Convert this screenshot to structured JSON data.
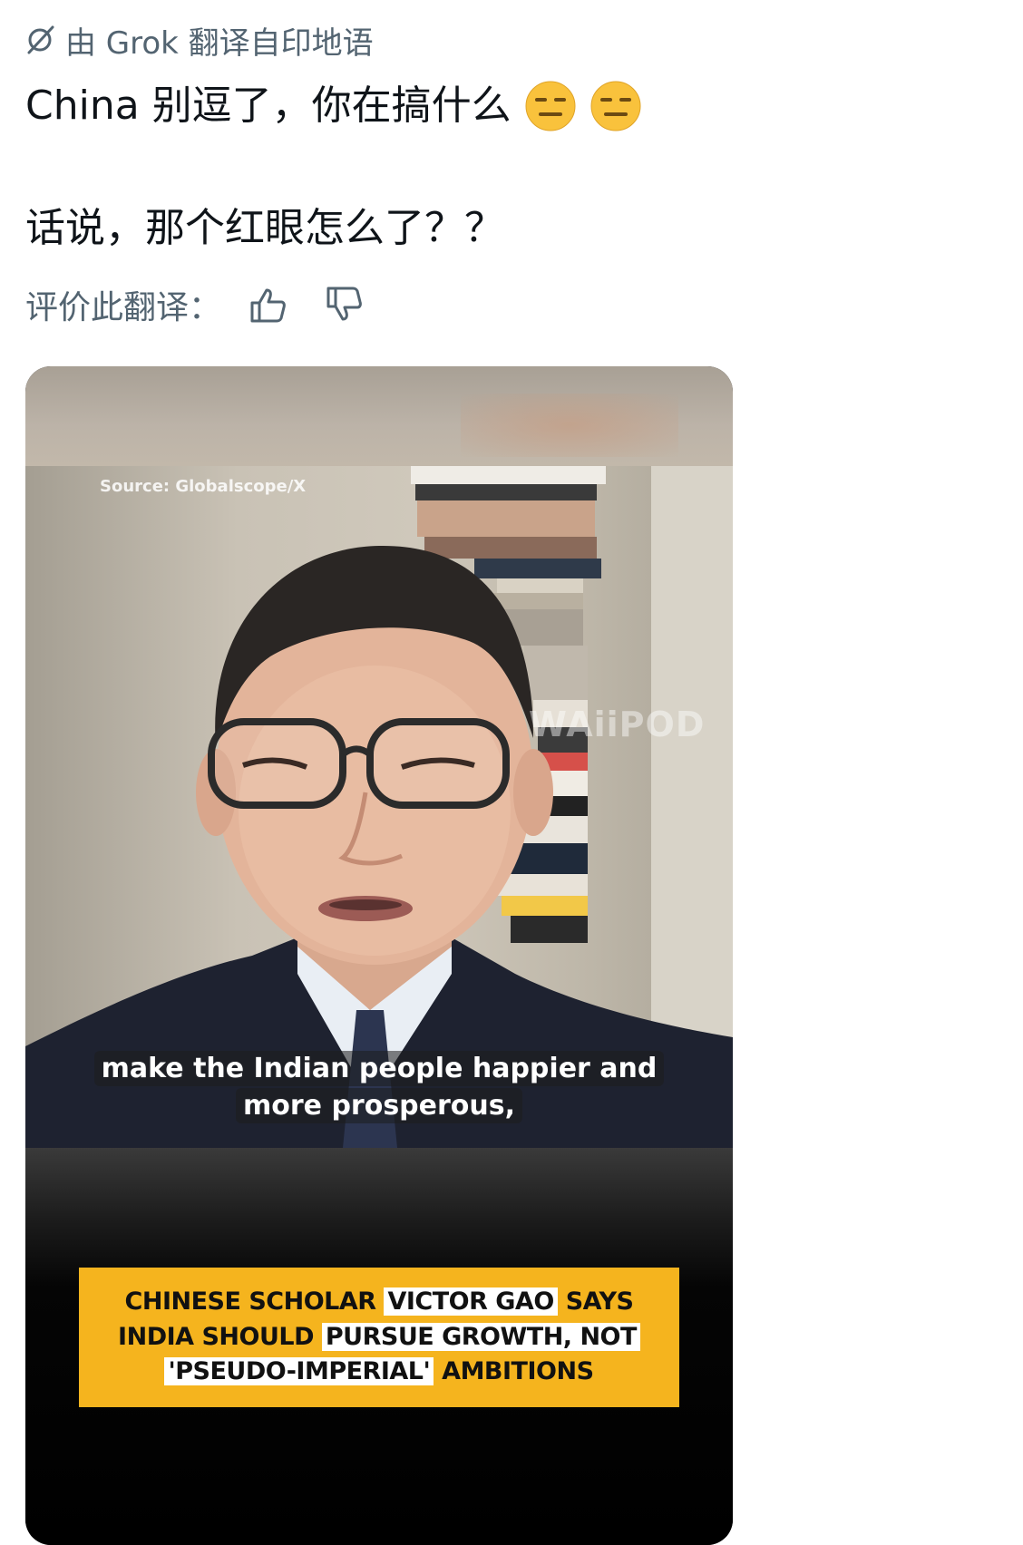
{
  "translation": {
    "label": "由 Grok 翻译自印地语"
  },
  "tweet": {
    "line1": "China 别逗了，你在搞什么",
    "emoji_icon": "expressionless-face-icon",
    "line2": "话说，那个红眼怎么了？？"
  },
  "rating": {
    "label": "评价此翻译："
  },
  "video": {
    "source": "Source: Globalscope/X",
    "watermark": "WAiiPOD",
    "subtitle_line1": "make the Indian people happier and",
    "subtitle_line2": "more prosperous,",
    "headline": {
      "l1a": "CHINESE SCHOLAR",
      "l1b": "VICTOR GAO",
      "l1c": "SAYS",
      "l2a": "INDIA SHOULD",
      "l2b": "PURSUE GROWTH, NOT",
      "l3a": "'PSEUDO-IMPERIAL'",
      "l3b": "AMBITIONS"
    },
    "headline_color": "#f5b41e"
  }
}
